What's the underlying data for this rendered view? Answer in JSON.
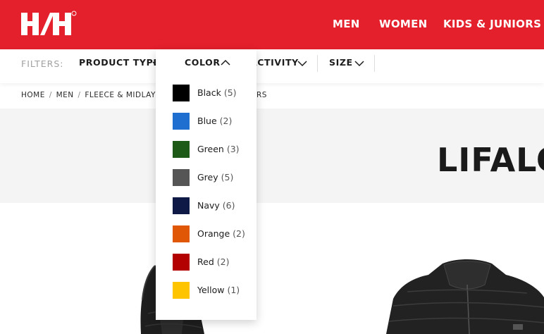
{
  "header": {
    "logo_alt": "HH",
    "nav": [
      {
        "label": "MEN"
      },
      {
        "label": "WOMEN"
      },
      {
        "label": "KIDS & JUNIORS"
      }
    ],
    "brand_color": "#e3202c"
  },
  "filter_bar": {
    "label": "FILTERS:",
    "filters": [
      {
        "label": "PRODUCT TYPE",
        "state": "collapsed"
      },
      {
        "label": "COLOR",
        "state": "expanded"
      },
      {
        "label": "ACTIVITY",
        "state": "collapsed"
      },
      {
        "label": "SIZE",
        "state": "collapsed"
      }
    ]
  },
  "color_dropdown": {
    "options": [
      {
        "name": "Black",
        "count": "(5)",
        "color": "#000000"
      },
      {
        "name": "Blue",
        "count": "(2)",
        "color": "#1f6fd1"
      },
      {
        "name": "Green",
        "count": "(3)",
        "color": "#1e5a17"
      },
      {
        "name": "Grey",
        "count": "(5)",
        "color": "#555555"
      },
      {
        "name": "Navy",
        "count": "(6)",
        "color": "#0e1a45"
      },
      {
        "name": "Orange",
        "count": "(2)",
        "color": "#e05806"
      },
      {
        "name": "Red",
        "count": "(2)",
        "color": "#b30000"
      },
      {
        "name": "Yellow",
        "count": "(1)",
        "color": "#ffc400"
      }
    ]
  },
  "breadcrumb": {
    "items": [
      "HOME",
      "MEN",
      "FLEECE & MIDLAYE"
    ],
    "current": "RS"
  },
  "hero": {
    "title": "LIFALO"
  }
}
